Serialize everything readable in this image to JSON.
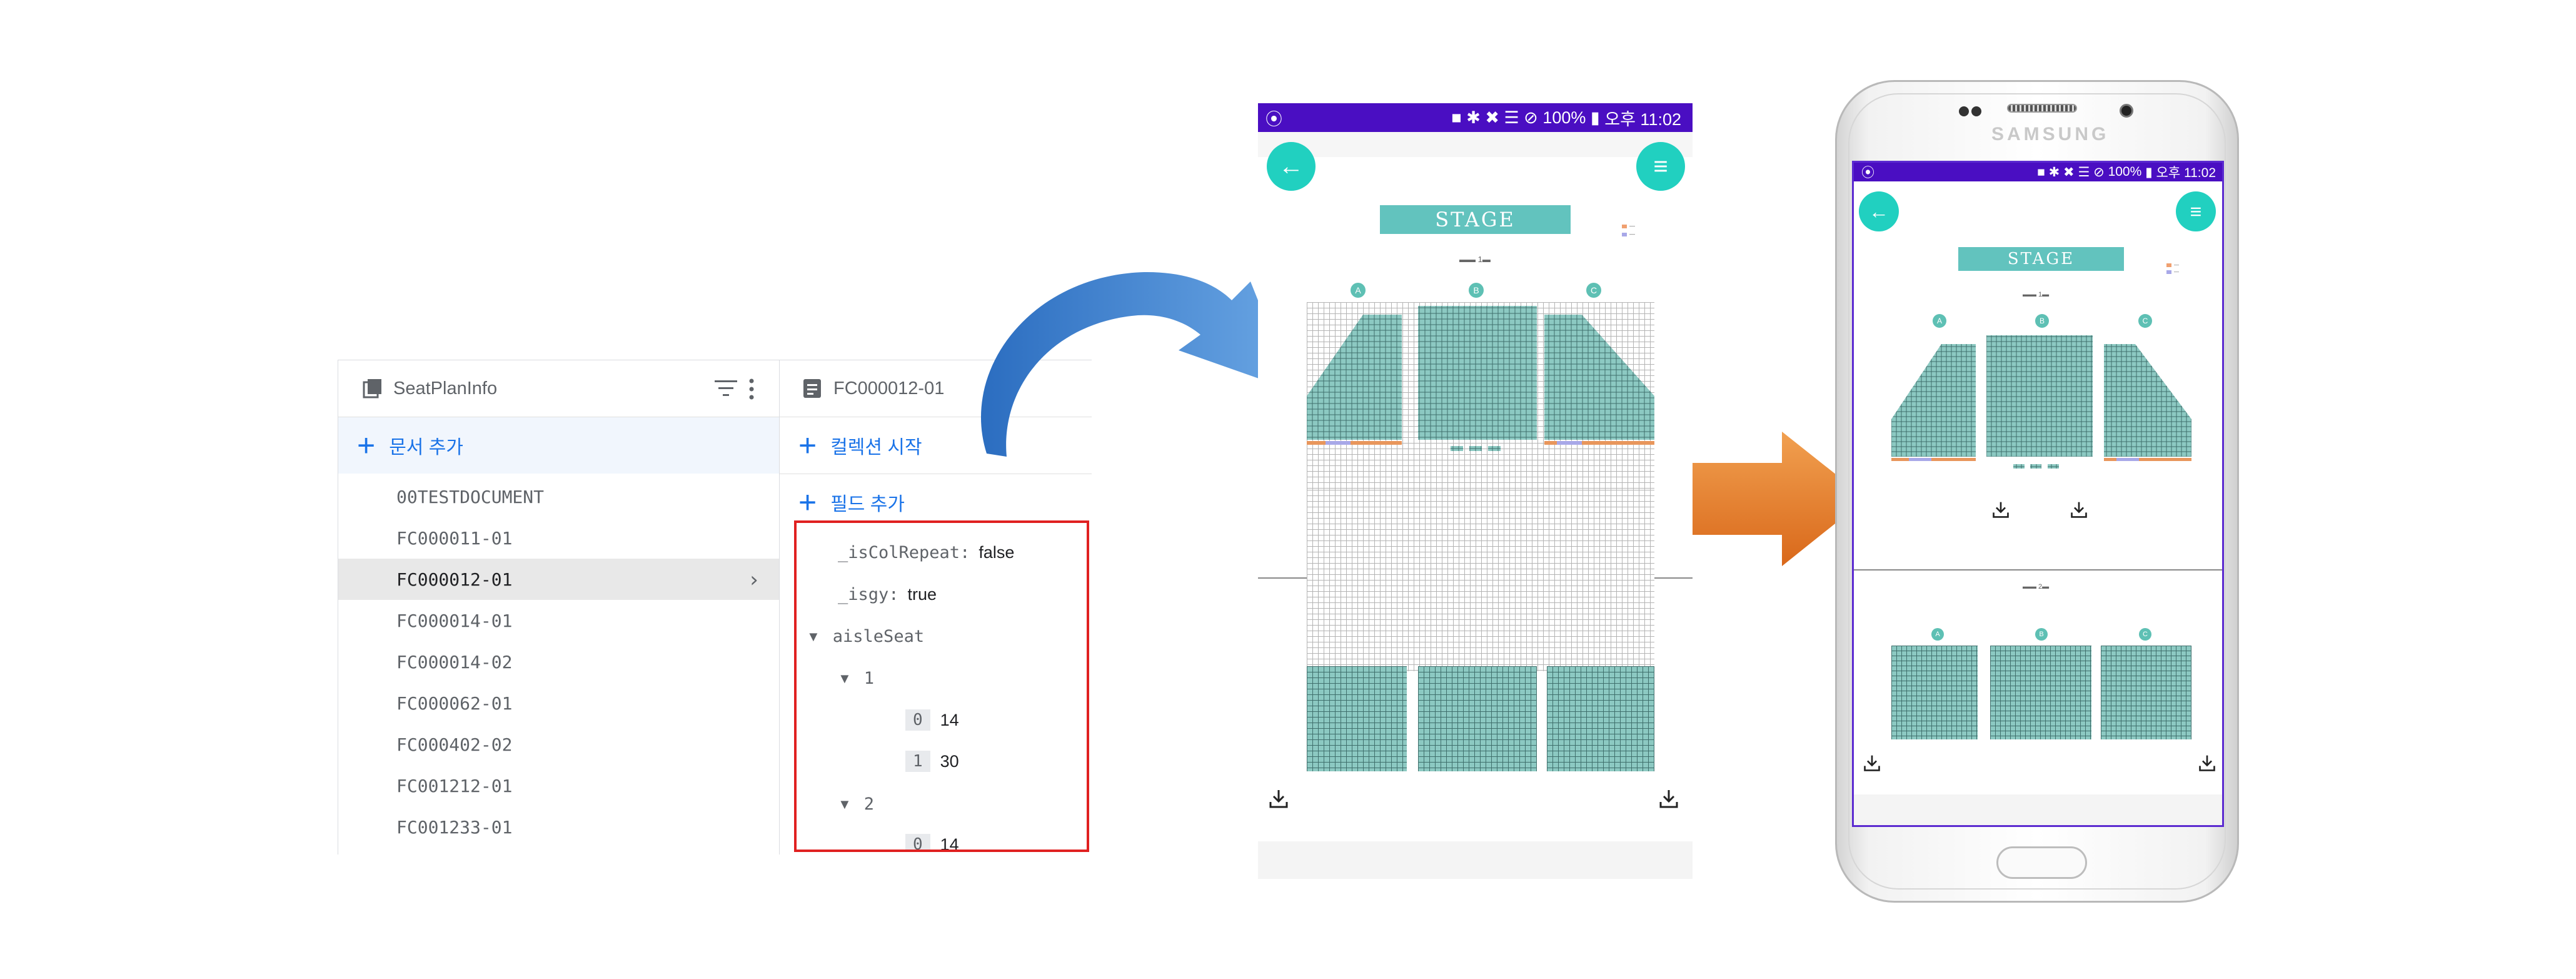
{
  "firestore": {
    "collection": {
      "title": "SeatPlanInfo",
      "add_document_label": "문서 추가",
      "documents": [
        "00TESTDOCUMENT",
        "FC000011-01",
        "FC000012-01",
        "FC000014-01",
        "FC000014-02",
        "FC000062-01",
        "FC000402-02",
        "FC001212-01",
        "FC001233-01"
      ],
      "selected_index": 2
    },
    "document": {
      "title": "FC000012-01",
      "start_collection_label": "컬렉션 시작",
      "add_field_label": "필드 추가",
      "fields": {
        "isColRepeat_key": "_isColRepeat:",
        "isColRepeat_value": "false",
        "isgy_key": "_isgy:",
        "isgy_value": "true",
        "aisleSeat_key": "aisleSeat",
        "group1_key": "1",
        "group1_items": [
          {
            "index": "0",
            "value": "14"
          },
          {
            "index": "1",
            "value": "30"
          }
        ],
        "group2_key": "2",
        "group2_items": [
          {
            "index": "0",
            "value": "14"
          }
        ]
      }
    }
  },
  "app": {
    "status_bar": {
      "left_icon": "screen-cast-icon",
      "battery": "100%",
      "time": "오후 11:02"
    },
    "stage_label": "STAGE",
    "legend": {
      "items": [
        {
          "color": "#f0a070"
        },
        {
          "color": "#a8a8e8"
        }
      ]
    },
    "section_labels": [
      "A",
      "B",
      "C"
    ],
    "colors": {
      "status_bar": "#4a0ec2",
      "accent": "#21d0c0",
      "stage": "#62c3be",
      "seat": "#8cc9c2"
    }
  },
  "phone": {
    "brand": "SAMSUNG"
  },
  "icons": {
    "left_arrow": "curved-blue-arrow",
    "right_arrow": "orange-arrow",
    "download": "download-icon",
    "back": "back-arrow-icon",
    "menu": "menu-icon"
  }
}
